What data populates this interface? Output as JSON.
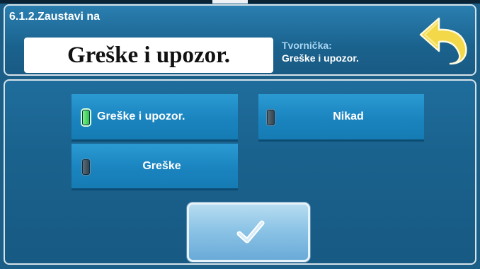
{
  "header": {
    "title": "6.1.2.Zaustavi na",
    "current_value": "Greške i upozor.",
    "factory_label": "Tvornička:",
    "factory_value": "Greške i upozor."
  },
  "options": [
    {
      "label": "Greške i upozor.",
      "selected": true
    },
    {
      "label": "Nikad",
      "selected": false
    },
    {
      "label": "Greške",
      "selected": false
    }
  ],
  "icons": {
    "back": "back-arrow-icon",
    "confirm": "checkmark-icon",
    "led_on": "green-indicator-icon",
    "led_off": "grey-indicator-icon"
  },
  "colors": {
    "background": "#1b5f88",
    "option_button": "#1a84bf",
    "led_on": "#2ec346",
    "back_arrow": "#f3d84a"
  }
}
